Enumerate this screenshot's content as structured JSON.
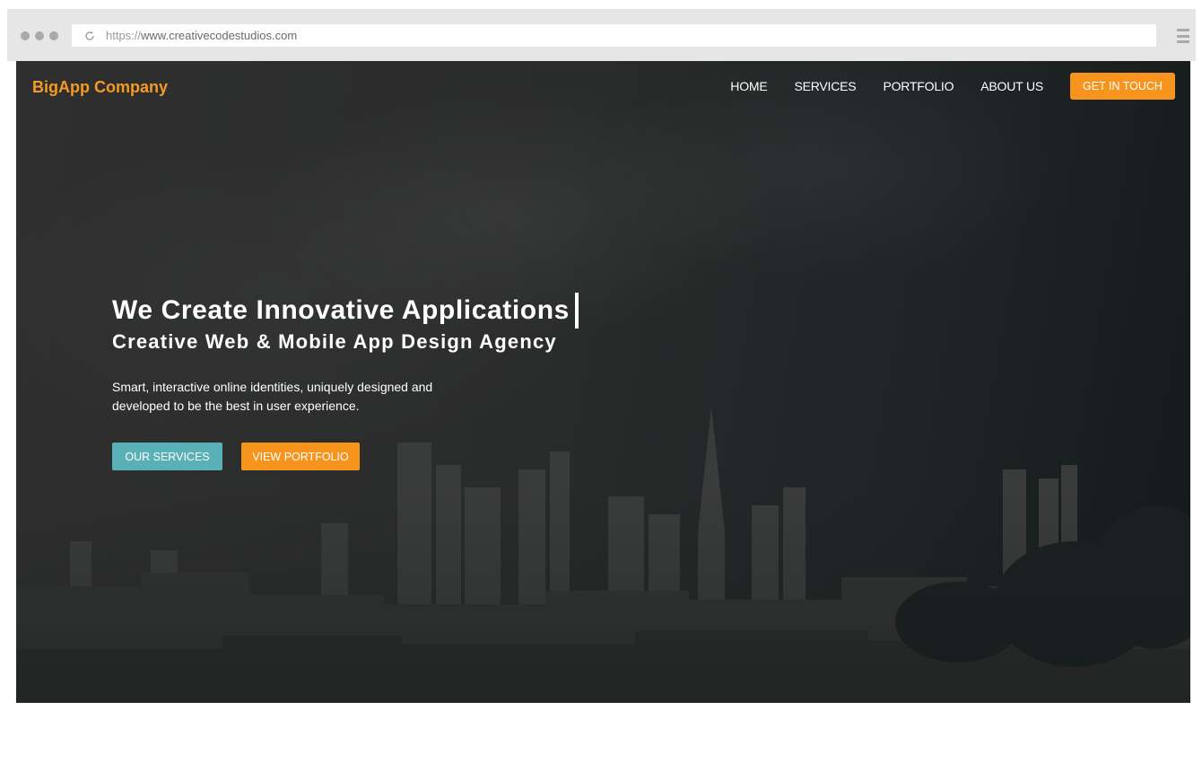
{
  "browser": {
    "url_prefix": "https://",
    "url_host": "www.creativecodestudios.com",
    "icons": [
      "window-dots-icon",
      "reload-icon",
      "hamburger-menu-icon"
    ]
  },
  "header": {
    "brand": "BigApp Company",
    "nav": [
      "HOME",
      "SERVICES",
      "PORTFOLIO",
      "ABOUT US"
    ],
    "cta": "GET IN TOUCH"
  },
  "hero": {
    "headline": "We Create Innovative Applications",
    "subheadline": "Creative Web & Mobile App Design Agency",
    "description": "Smart, interactive online identities, uniquely designed and developed to be the best in user experience.",
    "primary_button": "OUR SERVICES",
    "secondary_button": "VIEW PORTFOLIO"
  },
  "colors": {
    "accent_orange": "#f7941d",
    "brand_orange": "#f59a23",
    "teal": "#5ab0b7",
    "hero_dark": "#2b2b2b"
  }
}
